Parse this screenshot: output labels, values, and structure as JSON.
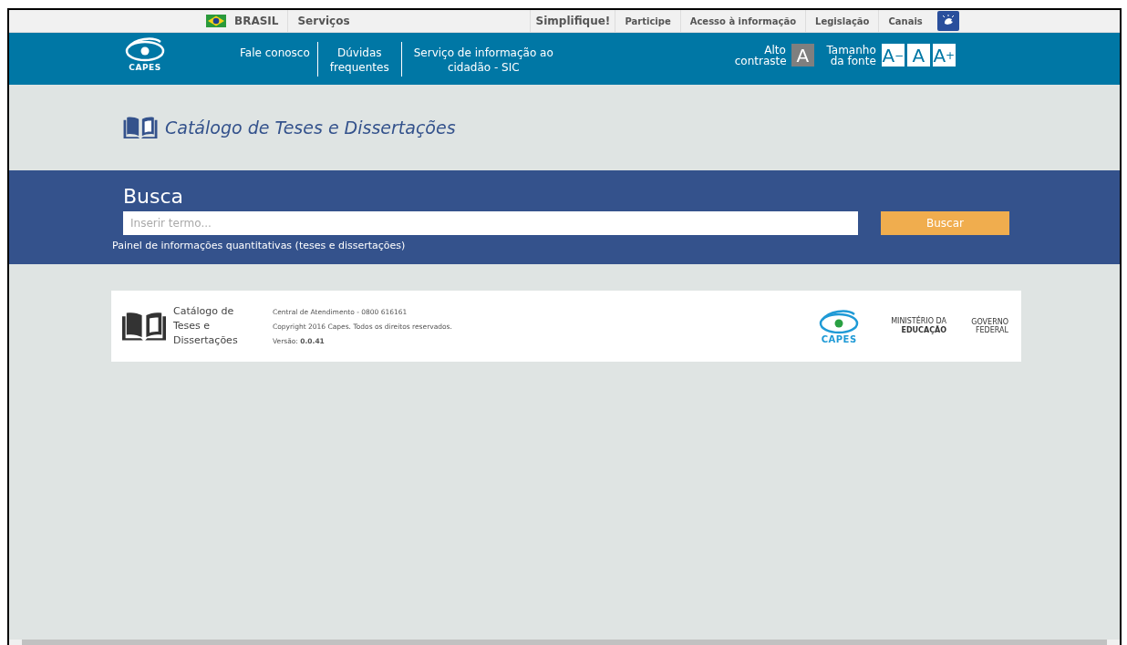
{
  "gov_bar": {
    "country": "BRASIL",
    "links": [
      {
        "label": "Serviços",
        "kind": "wide"
      },
      {
        "label": "Simplifique!",
        "kind": "main"
      },
      {
        "label": "Participe",
        "kind": "small"
      },
      {
        "label": "Acesso à informação",
        "kind": "small"
      },
      {
        "label": "Legislação",
        "kind": "small"
      },
      {
        "label": "Canais",
        "kind": "small"
      }
    ]
  },
  "header": {
    "logo_text": "CAPES",
    "links": [
      "Fale conosco",
      "Dúvidas frequentes",
      "Serviço de informação ao cidadão - SIC"
    ],
    "contrast_label": "Alto contraste",
    "contrast_button": "A",
    "font_size_label": "Tamanho da fonte",
    "font_buttons": [
      "A$^{−}$",
      "A",
      "A$^{+}$"
    ]
  },
  "catalog_title": "Catálogo de Teses e Dissertações",
  "search": {
    "heading": "Busca",
    "placeholder": "Inserir termo...",
    "button": "Buscar",
    "panel_link": "Painel de informações quantitativas (teses e dissertações)"
  },
  "footer": {
    "title": "Catálogo de Teses e Dissertações",
    "contact": "Central de Atendimento - 0800 616161",
    "copyright": "Copyright 2016 Capes. Todos os direitos reservados.",
    "version": "Versão: **0.0.41**",
    "capes_logo_text": "CAPES",
    "ministry": "MINISTÉRIO DA",
    "ministry_bold": "EDUCAÇÃO",
    "government": "GOVERNO FEDERAL"
  }
}
